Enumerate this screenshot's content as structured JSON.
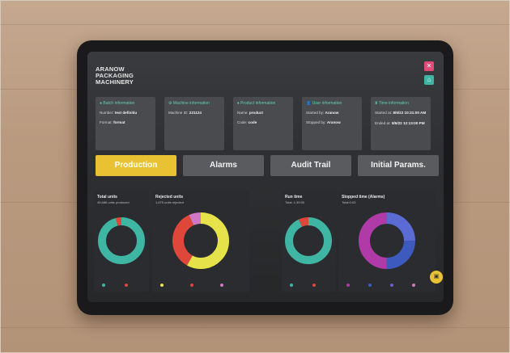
{
  "app": {
    "logo_line1": "ARANOW",
    "logo_line2": "PACKAGING",
    "logo_line3": "MACHINERY"
  },
  "info_cards": [
    {
      "title": "Batch information",
      "icon": "info-icon",
      "row1_label": "Number:",
      "row1_value": "test definitiu",
      "row2_label": "Format:",
      "row2_value": "format"
    },
    {
      "title": "Machine information",
      "icon": "gear-icon",
      "row1_label": "Machine ID:",
      "row1_value": "221124",
      "row2_label": "",
      "row2_value": ""
    },
    {
      "title": "Product information",
      "icon": "product-icon",
      "row1_label": "Name:",
      "row1_value": "product",
      "row2_label": "Code:",
      "row2_value": "code"
    },
    {
      "title": "User information",
      "icon": "user-icon",
      "row1_label": "Started by:",
      "row1_value": "Aranow",
      "row2_label": "Stopped by:",
      "row2_value": "Aranow"
    },
    {
      "title": "Time information",
      "icon": "hourglass-icon",
      "row1_label": "Started at:",
      "row1_value": "8/6/22 10:31:00 AM",
      "row2_label": "Ended at:",
      "row2_value": "8/6/22 12:13:00 PM"
    }
  ],
  "tabs": [
    {
      "label": "Production",
      "active": true
    },
    {
      "label": "Alarms",
      "active": false
    },
    {
      "label": "Audit Trail",
      "active": false
    },
    {
      "label": "Initial Params.",
      "active": false
    }
  ],
  "panels": [
    {
      "title": "Total units",
      "subtitle": "45,686 units produced"
    },
    {
      "title": "Rejected units",
      "subtitle": "1,675 units rejected"
    },
    {
      "title": "Run time",
      "subtitle": "Total: 1:39:00"
    },
    {
      "title": "Stopped time (Alarms)",
      "subtitle": "Total:0:03"
    }
  ],
  "colors": {
    "accent": "#e9c233",
    "teal": "#3fb5a3",
    "red": "#e0473b",
    "pink": "#e24a7a",
    "yellow": "#e6e24a",
    "purple": "#b03aa8",
    "blue": "#3d5bbf",
    "lavender": "#6a5fd0"
  },
  "chart_data": [
    {
      "type": "pie",
      "title": "Total units",
      "slices": [
        {
          "value": 96,
          "color": "#3fb5a3"
        },
        {
          "value": 4,
          "color": "#e0473b"
        }
      ]
    },
    {
      "type": "pie",
      "title": "Rejected units",
      "slices": [
        {
          "value": 58,
          "color": "#e6e24a"
        },
        {
          "value": 35,
          "color": "#e0473b"
        },
        {
          "value": 7,
          "color": "#d178c4"
        }
      ]
    },
    {
      "type": "pie",
      "title": "Run time",
      "slices": [
        {
          "value": 93,
          "color": "#3fb5a3"
        },
        {
          "value": 7,
          "color": "#e0473b"
        }
      ]
    },
    {
      "type": "pie",
      "title": "Stopped time (Alarms)",
      "slices": [
        {
          "value": 25,
          "color": "#5a6bd4"
        },
        {
          "value": 25,
          "color": "#3d5bbf"
        },
        {
          "value": 50,
          "color": "#b03aa8"
        }
      ]
    }
  ]
}
